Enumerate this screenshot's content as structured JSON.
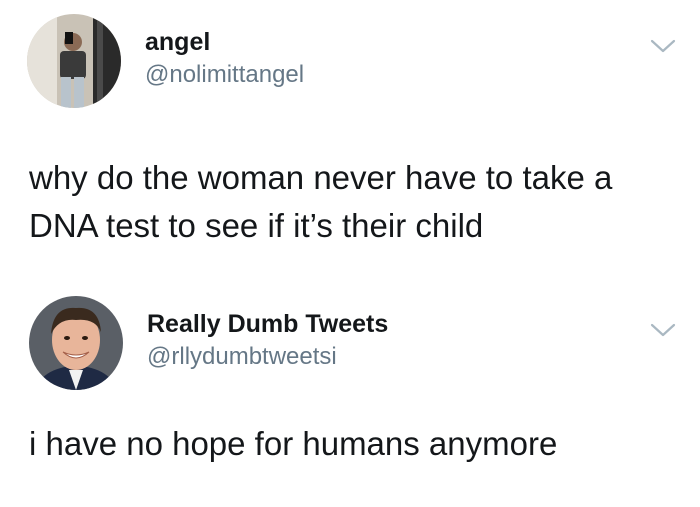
{
  "tweets": [
    {
      "display_name": "angel",
      "handle": "@nolimittangel",
      "text": "why do the woman never have to take a DNA test to see if it’s their child",
      "avatar_icon": "user-photo-avatar",
      "menu_icon": "chevron-down-icon"
    },
    {
      "display_name": "Really Dumb Tweets",
      "handle": "@rllydumbtweetsi",
      "text": "i have no hope for humans anymore",
      "avatar_icon": "user-photo-avatar",
      "menu_icon": "chevron-down-icon"
    }
  ],
  "colors": {
    "background": "#ffffff",
    "primary_text": "#14171a",
    "secondary_text": "#657786",
    "chevron": "#aab8c2"
  }
}
